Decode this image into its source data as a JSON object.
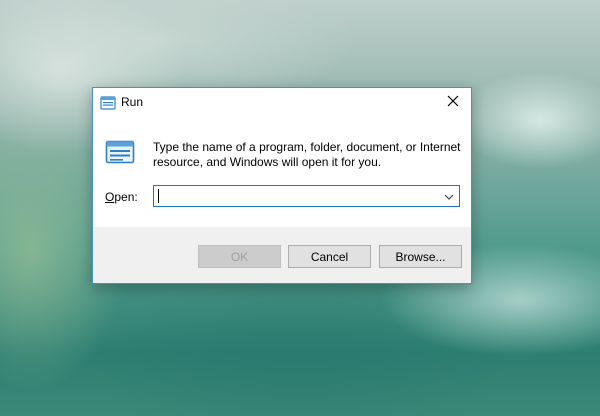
{
  "window": {
    "title": "Run",
    "title_icon": "run-icon",
    "close_icon": "close-icon"
  },
  "content": {
    "icon": "run-icon",
    "description_line1": "Type the name of a program, folder, document, or Internet",
    "description_line2": "resource, and Windows will open it for you."
  },
  "open_field": {
    "label_accel": "O",
    "label_rest": "pen:",
    "value": "",
    "dropdown_icon": "chevron-down-icon"
  },
  "buttons": {
    "ok_label": "OK",
    "cancel_label": "Cancel",
    "browse_label": "Browse..."
  },
  "colors": {
    "accent": "#1e73be",
    "dialog_border": "#4a90c9",
    "footer_bg": "#f0f0f0"
  }
}
